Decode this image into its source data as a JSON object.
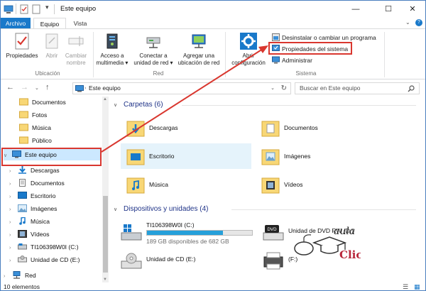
{
  "window": {
    "title": "Este equipo",
    "minimize": "—",
    "maximize": "☐",
    "close": "✕"
  },
  "tabs": {
    "file": "Archivo",
    "equipo": "Equipo",
    "vista": "Vista"
  },
  "ribbon": {
    "propiedades": "Propiedades",
    "abrir": "Abrir",
    "cambiar_1": "Cambiar",
    "cambiar_2": "nombre",
    "acceso_1": "Acceso a",
    "acceso_2": "multimedia ▾",
    "conectar_1": "Conectar a",
    "conectar_2": "unidad de red ▾",
    "agregar_1": "Agregar una",
    "agregar_2": "ubicación de red",
    "abrir_conf_1": "Abrir",
    "abrir_conf_2": "configuración",
    "group_ubicacion": "Ubicación",
    "group_red": "Red",
    "group_sistema": "Sistema",
    "desinstalar": "Desinstalar o cambiar un programa",
    "propiedades_sistema": "Propiedades del sistema",
    "administrar": "Administrar"
  },
  "address": {
    "path": "Este equipo",
    "search_placeholder": "Buscar en Este equipo"
  },
  "sidebar": {
    "items": [
      {
        "label": "Documentos"
      },
      {
        "label": "Fotos"
      },
      {
        "label": "Música"
      },
      {
        "label": "Público"
      },
      {
        "label": "Este equipo"
      },
      {
        "label": "Descargas"
      },
      {
        "label": "Documentos"
      },
      {
        "label": "Escritorio"
      },
      {
        "label": "Imágenes"
      },
      {
        "label": "Música"
      },
      {
        "label": "Vídeos"
      },
      {
        "label": "TI106398W0I (C:)"
      },
      {
        "label": "Unidad de CD (E:)"
      },
      {
        "label": "Red"
      }
    ]
  },
  "main": {
    "folders_header": "Carpetas (6)",
    "folders": [
      {
        "label": "Descargas"
      },
      {
        "label": "Documentos"
      },
      {
        "label": "Escritorio"
      },
      {
        "label": "Imágenes"
      },
      {
        "label": "Música"
      },
      {
        "label": "Vídeos"
      }
    ],
    "devices_header": "Dispositivos y unidades (4)",
    "drives": [
      {
        "label": "TI106398W0I (C:)",
        "space": "189 GB disponibles de 682 GB",
        "used_fraction": 0.72
      },
      {
        "label": "Unidad de DVD RW (D:)"
      },
      {
        "label": "Unidad de CD (E:)"
      },
      {
        "label": "(F:)"
      }
    ]
  },
  "status": {
    "count": "10 elementos"
  },
  "watermark": {
    "text_1": "aula",
    "text_2": "Clic"
  },
  "colors": {
    "accent": "#1979ca",
    "highlight_red": "#d9372f",
    "header_blue": "#1e3287"
  }
}
